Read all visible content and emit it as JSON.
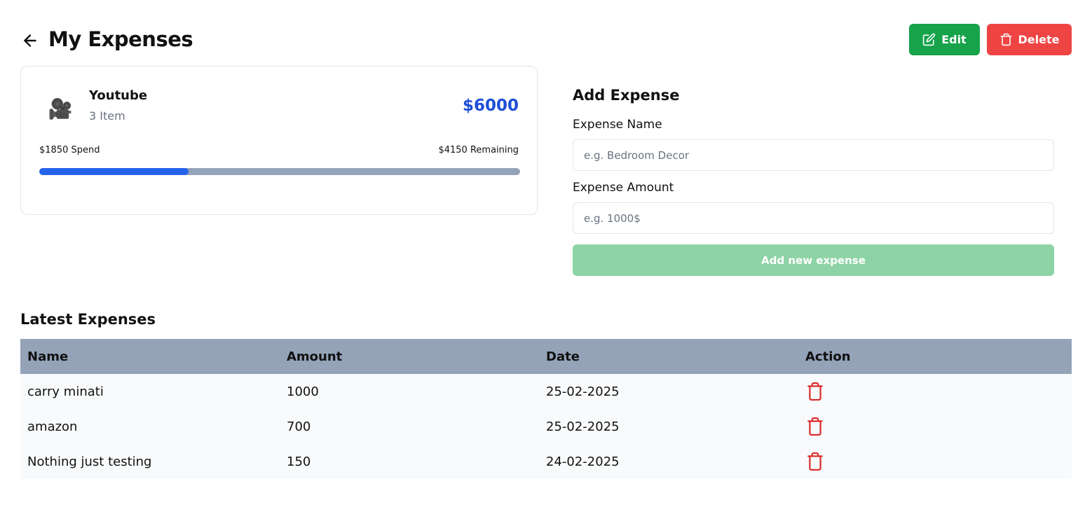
{
  "header": {
    "title": "My Expenses",
    "back_icon": "arrow-left-icon",
    "edit_label": "Edit",
    "delete_label": "Delete"
  },
  "budget": {
    "icon": "🎥",
    "name": "Youtube",
    "items": "3 Item",
    "total": "$6000",
    "spend": "$1850 Spend",
    "remaining": "$4150 Remaining",
    "progress": 0.31
  },
  "add_form": {
    "title": "Add Expense",
    "name_label": "Expense Name",
    "name_placeholder": "e.g. Bedroom Decor",
    "amount_label": "Expense Amount",
    "amount_placeholder": "e.g. 1000$",
    "submit_label": "Add new expense"
  },
  "latest": {
    "title": "Latest Expenses",
    "columns": [
      "Name",
      "Amount",
      "Date",
      "Action"
    ],
    "rows": [
      {
        "name": "carry minati",
        "amount": "1000",
        "date": "25-02-2025"
      },
      {
        "name": "amazon",
        "amount": "700",
        "date": "25-02-2025"
      },
      {
        "name": "Nothing just testing",
        "amount": "150",
        "date": "24-02-2025"
      }
    ]
  },
  "colors": {
    "edit": "#16a34a",
    "delete": "#ef4444",
    "accent": "#1d4ed8",
    "progress": "#2563eb",
    "track": "#94a3b8",
    "add_button": "#8ed3a5",
    "trash": "#dc2626"
  }
}
